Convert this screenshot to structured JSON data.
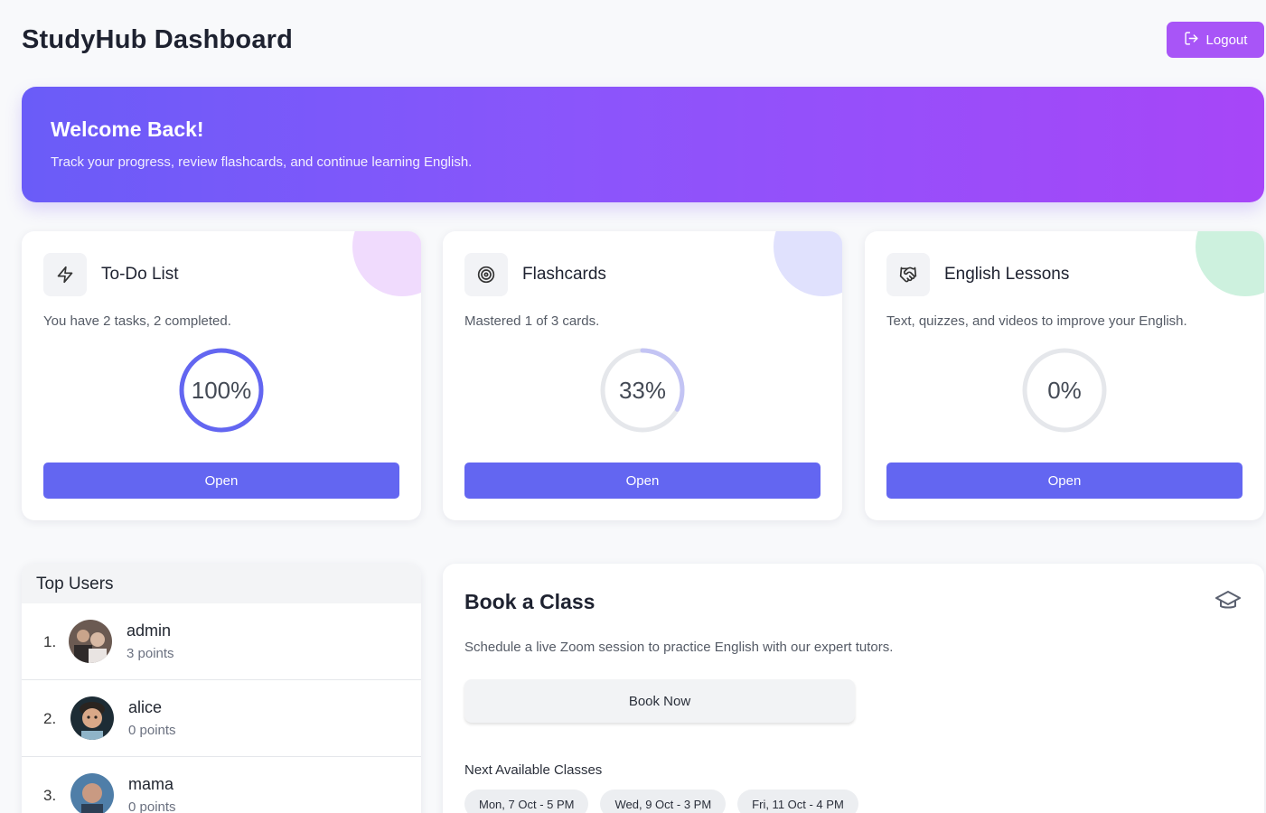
{
  "header": {
    "title": "StudyHub Dashboard",
    "logout_label": "Logout"
  },
  "hero": {
    "title": "Welcome Back!",
    "subtitle": "Track your progress, review flashcards, and continue learning English."
  },
  "cards": [
    {
      "title": "To-Do List",
      "description": "You have 2 tasks, 2 completed.",
      "progress_label": "100%",
      "progress": 1.0,
      "ring_color": "#6366f1",
      "blob_color": "#f0dbfd",
      "icon": "lightning-icon",
      "button_label": "Open"
    },
    {
      "title": "Flashcards",
      "description": "Mastered 1 of 3 cards.",
      "progress_label": "33%",
      "progress": 0.33,
      "ring_color": "#c3c4f4",
      "blob_color": "#e0e1fd",
      "icon": "target-icon",
      "button_label": "Open"
    },
    {
      "title": "English Lessons",
      "description": "Text, quizzes, and videos to improve your English.",
      "progress_label": "0%",
      "progress": 0,
      "ring_color": "#6366f1",
      "blob_color": "#cdf1de",
      "icon": "handshake-icon",
      "button_label": "Open"
    }
  ],
  "top_users": {
    "title": "Top Users",
    "users": [
      {
        "rank": "1.",
        "name": "admin",
        "points": "3 points"
      },
      {
        "rank": "2.",
        "name": "alice",
        "points": "0 points"
      },
      {
        "rank": "3.",
        "name": "mama",
        "points": "0 points"
      }
    ]
  },
  "book_class": {
    "title": "Book a Class",
    "description": "Schedule a live Zoom session to practice English with our expert tutors.",
    "button_label": "Book Now",
    "next_label": "Next Available Classes",
    "slots": [
      "Mon, 7 Oct - 5 PM",
      "Wed, 9 Oct - 3 PM",
      "Fri, 11 Oct - 4 PM"
    ]
  },
  "colors": {
    "accent": "#6366f1",
    "logout": "#a855f7",
    "hero_gradient_start": "#6a5cf8",
    "hero_gradient_end": "#a746f8"
  }
}
